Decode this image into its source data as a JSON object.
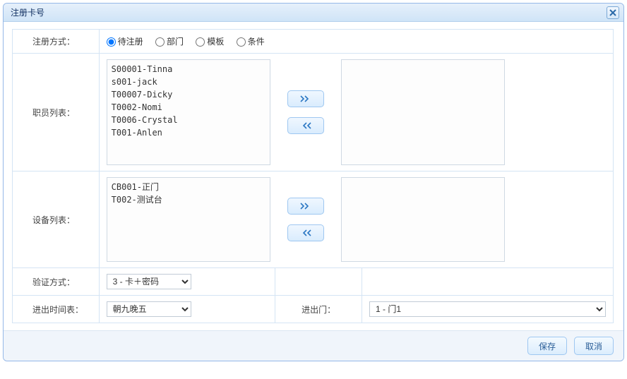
{
  "dialog": {
    "title": "注册卡号"
  },
  "rows": {
    "regType": {
      "label": "注册方式：",
      "options": [
        {
          "label": "待注册",
          "checked": true
        },
        {
          "label": "部门",
          "checked": false
        },
        {
          "label": "模板",
          "checked": false
        },
        {
          "label": "条件",
          "checked": false
        }
      ]
    },
    "staffList": {
      "label": "职员列表：",
      "left": [
        "S00001-Tinna",
        "s001-jack",
        "T00007-Dicky",
        "T0002-Nomi",
        "T0006-Crystal",
        "T001-Anlen"
      ],
      "right": []
    },
    "deviceList": {
      "label": "设备列表：",
      "left": [
        "CB001-正门",
        "T002-测试台"
      ],
      "right": []
    },
    "verify": {
      "label": "验证方式：",
      "selected": "3 - 卡＋密码"
    },
    "schedule": {
      "label": "进出时间表：",
      "selected": "朝九晚五"
    },
    "door": {
      "label": "进出门：",
      "selected": "1 - 门1"
    }
  },
  "footer": {
    "save": "保存",
    "cancel": "取消"
  }
}
